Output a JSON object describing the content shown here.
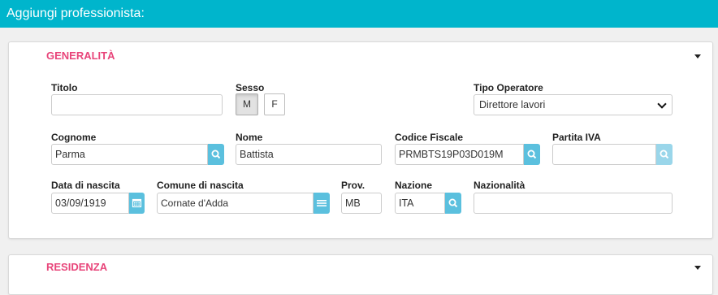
{
  "header": {
    "title": "Aggiungi professionista:"
  },
  "sections": {
    "generalita": {
      "title": "GENERALITÀ"
    },
    "residenza": {
      "title": "RESIDENZA"
    }
  },
  "form": {
    "titolo": {
      "label": "Titolo",
      "value": ""
    },
    "sesso": {
      "label": "Sesso",
      "options": [
        "M",
        "F"
      ],
      "selected": "M"
    },
    "tipo_operatore": {
      "label": "Tipo Operatore",
      "value": "Direttore lavori"
    },
    "cognome": {
      "label": "Cognome",
      "value": "Parma"
    },
    "nome": {
      "label": "Nome",
      "value": "Battista"
    },
    "codice_fiscale": {
      "label": "Codice Fiscale",
      "value": "PRMBTS19P03D019M"
    },
    "partita_iva": {
      "label": "Partita IVA",
      "value": ""
    },
    "data_nascita": {
      "label": "Data di nascita",
      "value": "03/09/1919"
    },
    "comune_nascita": {
      "label": "Comune di nascita",
      "value": "Cornate d'Adda"
    },
    "prov": {
      "label": "Prov.",
      "value": "MB"
    },
    "nazione": {
      "label": "Nazione",
      "value": "ITA"
    },
    "nazionalita": {
      "label": "Nazionalità",
      "value": ""
    }
  },
  "colors": {
    "header": "#00b5cc",
    "section_title": "#e8457a",
    "addon": "#5bc0de"
  },
  "icons": [
    "search-icon",
    "calendar-icon",
    "list-icon",
    "caret-down-icon",
    "chevron-down-icon"
  ]
}
